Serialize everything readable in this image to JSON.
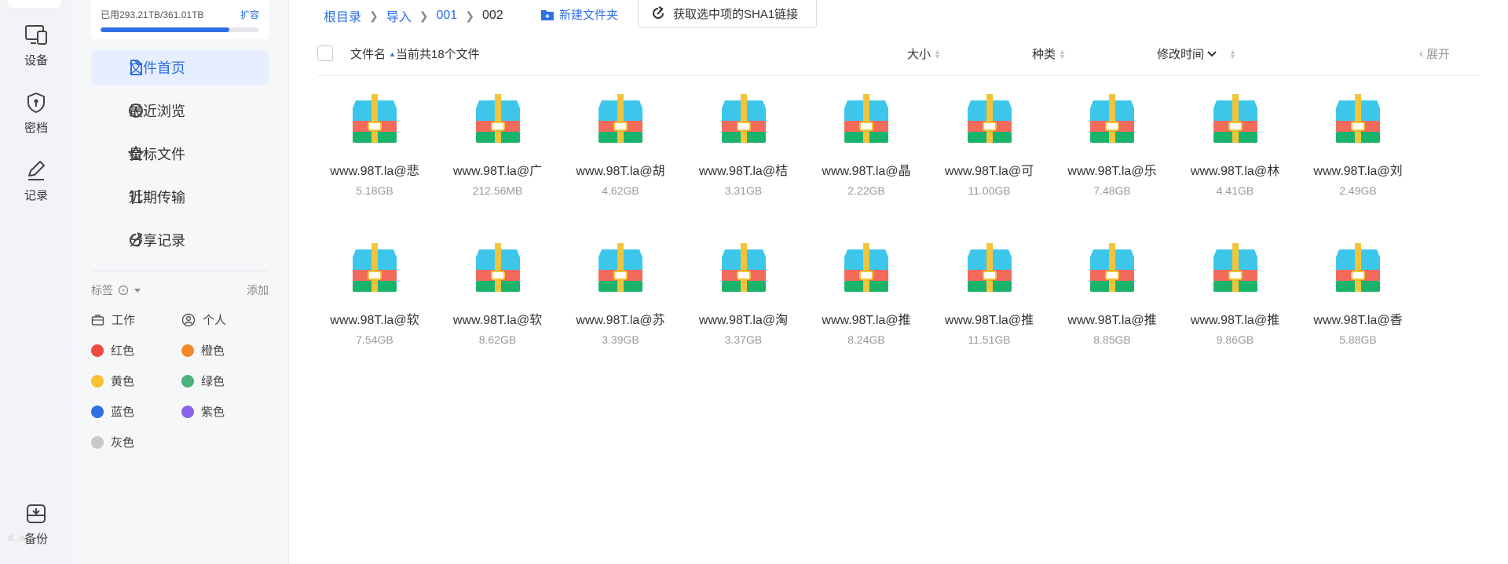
{
  "rail": {
    "items": [
      {
        "label": "设备",
        "icon": "devices-icon"
      },
      {
        "label": "密档",
        "icon": "shield-lock-icon"
      },
      {
        "label": "记录",
        "icon": "edit-icon"
      },
      {
        "label": "备份",
        "icon": "archive-icon"
      }
    ],
    "footer_text": "d...w.9"
  },
  "quota": {
    "used_text": "已用293.21TB/361.01TB",
    "expand_label": "扩容",
    "fraction": 0.812
  },
  "nav": [
    {
      "label": "文件首页",
      "icon": "file-icon",
      "active": true
    },
    {
      "label": "最近浏览",
      "icon": "history-icon"
    },
    {
      "label": "星标文件",
      "icon": "star-icon"
    },
    {
      "label": "近期传输",
      "icon": "transfer-icon"
    },
    {
      "label": "分享记录",
      "icon": "share-icon"
    }
  ],
  "tags": {
    "title": "标签",
    "add_label": "添加",
    "items": [
      {
        "label": "工作",
        "icon": "briefcase-icon"
      },
      {
        "label": "个人",
        "icon": "user-icon"
      },
      {
        "label": "红色",
        "color": "#f04a3e"
      },
      {
        "label": "橙色",
        "color": "#f5892a"
      },
      {
        "label": "黄色",
        "color": "#f8c12f"
      },
      {
        "label": "绿色",
        "color": "#4db17b"
      },
      {
        "label": "蓝色",
        "color": "#2f6fe4"
      },
      {
        "label": "紫色",
        "color": "#8a63e8"
      },
      {
        "label": "灰色",
        "color": "#c8c8c8"
      }
    ]
  },
  "breadcrumb": [
    "根目录",
    "导入",
    "001",
    "002"
  ],
  "toolbar": {
    "new_folder": "新建文件夹",
    "sha1": "获取选中项的SHA1链接"
  },
  "table_header": {
    "name": "文件名",
    "count_text": "当前共18个文件",
    "size": "大小",
    "type": "种类",
    "modified": "修改时间",
    "expand": "展开"
  },
  "files": [
    {
      "name": "www.98T.la@悲",
      "size": "5.18GB"
    },
    {
      "name": "www.98T.la@广",
      "size": "212.56MB"
    },
    {
      "name": "www.98T.la@胡",
      "size": "4.62GB"
    },
    {
      "name": "www.98T.la@桔",
      "size": "3.31GB"
    },
    {
      "name": "www.98T.la@晶",
      "size": "2.22GB"
    },
    {
      "name": "www.98T.la@可",
      "size": "11.00GB"
    },
    {
      "name": "www.98T.la@乐",
      "size": "7.48GB"
    },
    {
      "name": "www.98T.la@林",
      "size": "4.41GB"
    },
    {
      "name": "www.98T.la@刘",
      "size": "2.49GB"
    },
    {
      "name": "www.98T.la@软",
      "size": "7.54GB"
    },
    {
      "name": "www.98T.la@软",
      "size": "8.62GB"
    },
    {
      "name": "www.98T.la@苏",
      "size": "3.39GB"
    },
    {
      "name": "www.98T.la@淘",
      "size": "3.37GB"
    },
    {
      "name": "www.98T.la@推",
      "size": "8.24GB"
    },
    {
      "name": "www.98T.la@推",
      "size": "11.51GB"
    },
    {
      "name": "www.98T.la@推",
      "size": "8.85GB"
    },
    {
      "name": "www.98T.la@推",
      "size": "9.86GB"
    },
    {
      "name": "www.98T.la@香",
      "size": "5.88GB"
    }
  ],
  "colors": {
    "accent": "#2f6fe4",
    "archive_top": "#3cc7ea",
    "archive_band": "#f26a5a",
    "archive_bottom": "#19b36b",
    "archive_zip": "#f3c43a"
  }
}
